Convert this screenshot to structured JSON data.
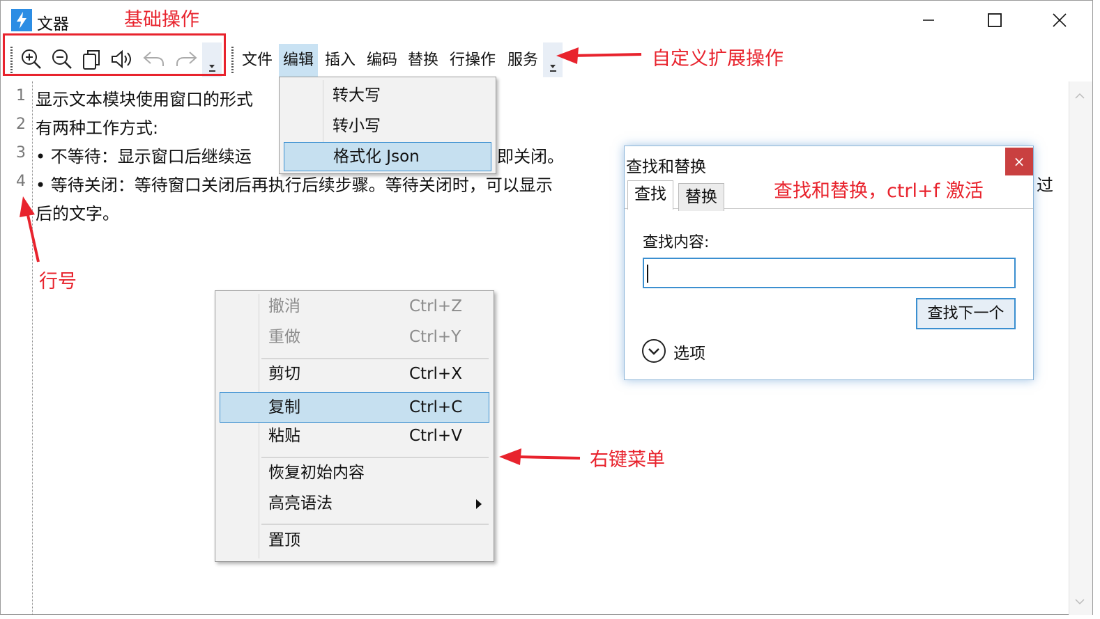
{
  "window": {
    "title": "文器"
  },
  "menu": [
    "文件",
    "编辑",
    "插入",
    "编码",
    "替换",
    "行操作",
    "服务"
  ],
  "edit_dropdown": [
    "转大写",
    "转小写",
    "格式化 Json"
  ],
  "editor": {
    "line_numbers": [
      "1",
      "2",
      "3",
      "4"
    ],
    "lines": [
      "显示文本模块使用窗口的形式",
      "有两种工作方式:",
      "•  不等待：显示窗口后继续运",
      "•  等待关闭：等待窗口关闭后再执行后续步骤。等待关闭时，可以显示",
      "后的文字。"
    ],
    "hidden_fragments": {
      "line3_tail": "即关闭。",
      "line4_tail": "过"
    }
  },
  "context_menu": {
    "undo": {
      "label": "撤消",
      "shortcut": "Ctrl+Z"
    },
    "redo": {
      "label": "重做",
      "shortcut": "Ctrl+Y"
    },
    "cut": {
      "label": "剪切",
      "shortcut": "Ctrl+X"
    },
    "copy": {
      "label": "复制",
      "shortcut": "Ctrl+C"
    },
    "paste": {
      "label": "粘贴",
      "shortcut": "Ctrl+V"
    },
    "restore": "恢复初始内容",
    "highlight": "高亮语法",
    "pin": "置顶"
  },
  "find_dialog": {
    "title": "查找和替换",
    "close": "×",
    "tabs": [
      "查找",
      "替换"
    ],
    "find_label": "查找内容:",
    "find_value": "",
    "find_next": "查找下一个",
    "options": "选项"
  },
  "annotations": {
    "basic_ops": "基础操作",
    "custom_ext": "自定义扩展操作",
    "line_number": "行号",
    "right_menu": "右键菜单",
    "find_replace": "查找和替换，ctrl+f 激活"
  },
  "colors": {
    "annotation": "#e8232d",
    "selection": "#c6e0f0",
    "accent": "#3b8fd0",
    "close": "#c94040"
  }
}
